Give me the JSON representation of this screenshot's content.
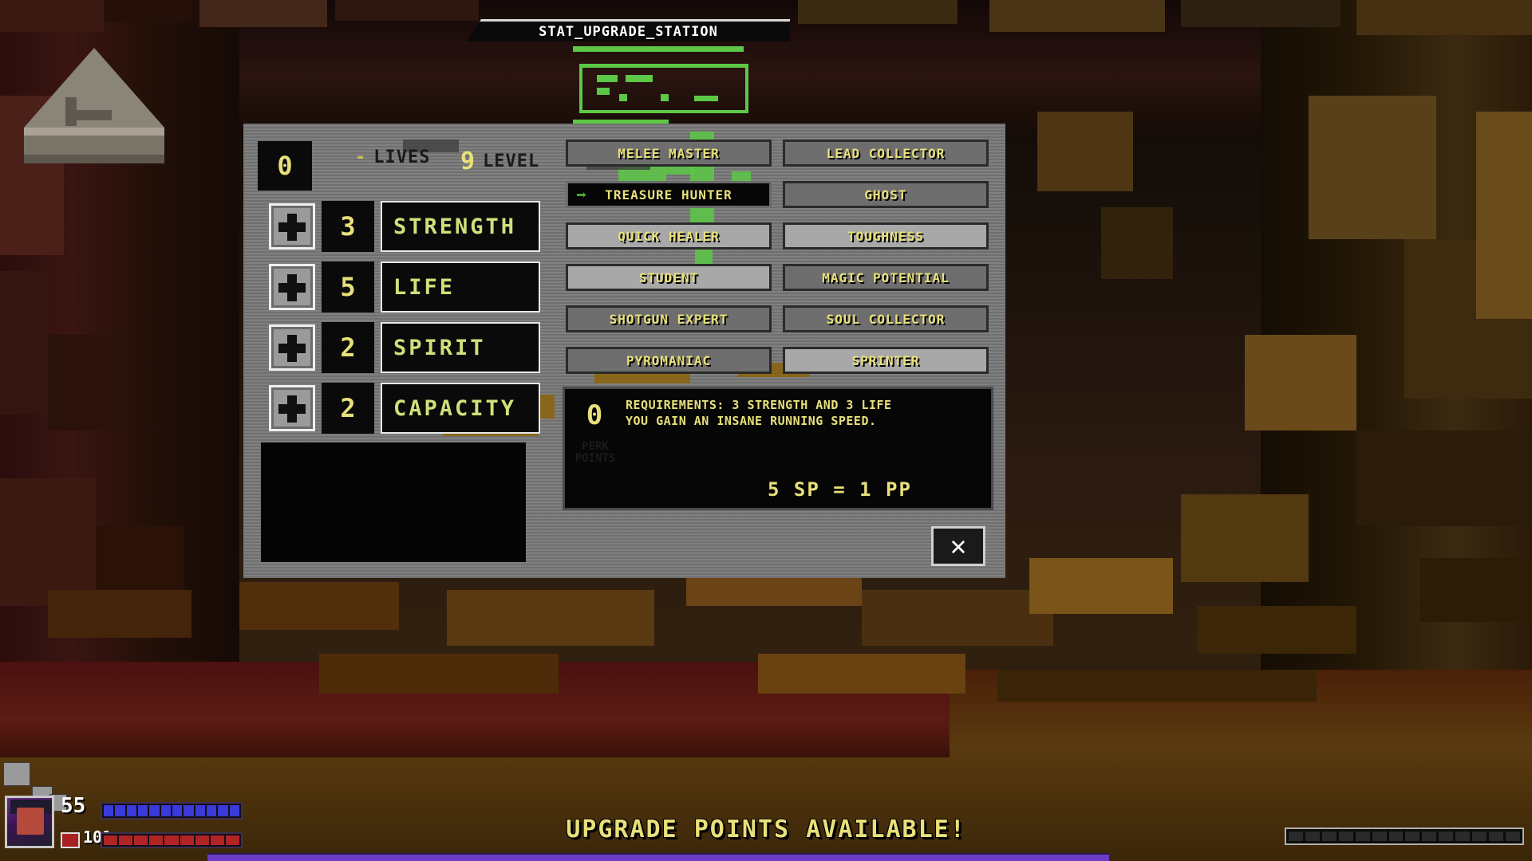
{
  "title_bar": {
    "text": "STAT_UPGRADE_STATION"
  },
  "hud_top": {
    "stat_points": "0",
    "lives_separator": "-",
    "lives_label": "LIVES",
    "level_value": "9",
    "level_label": "LEVEL"
  },
  "stats": [
    {
      "value": "3",
      "name": "STRENGTH",
      "plus_icon": "plus-icon"
    },
    {
      "value": "5",
      "name": "LIFE",
      "plus_icon": "plus-icon"
    },
    {
      "value": "2",
      "name": "SPIRIT",
      "plus_icon": "plus-icon"
    },
    {
      "value": "2",
      "name": "CAPACITY",
      "plus_icon": "plus-icon"
    }
  ],
  "perks": [
    {
      "label": "MELEE MASTER",
      "column": "left",
      "row": 0,
      "state": "available",
      "selected": false
    },
    {
      "label": "LEAD COLLECTOR",
      "column": "right",
      "row": 0,
      "state": "available",
      "selected": false
    },
    {
      "label": "TREASURE HUNTER",
      "column": "left",
      "row": 1,
      "state": "available",
      "selected": true
    },
    {
      "label": "GHOST",
      "column": "right",
      "row": 1,
      "state": "available",
      "selected": false
    },
    {
      "label": "QUICK HEALER",
      "column": "left",
      "row": 2,
      "state": "owned",
      "selected": false
    },
    {
      "label": "TOUGHNESS",
      "column": "right",
      "row": 2,
      "state": "owned",
      "selected": false
    },
    {
      "label": "STUDENT",
      "column": "left",
      "row": 3,
      "state": "owned",
      "selected": false
    },
    {
      "label": "MAGIC POTENTIAL",
      "column": "right",
      "row": 3,
      "state": "available",
      "selected": false
    },
    {
      "label": "SHOTGUN EXPERT",
      "column": "left",
      "row": 4,
      "state": "available",
      "selected": false
    },
    {
      "label": "SOUL COLLECTOR",
      "column": "right",
      "row": 4,
      "state": "available",
      "selected": false
    },
    {
      "label": "PYROMANIAC",
      "column": "left",
      "row": 5,
      "state": "available",
      "selected": false
    },
    {
      "label": "SPRINTER",
      "column": "right",
      "row": 5,
      "state": "owned",
      "selected": false
    }
  ],
  "selection_arrow": "➡",
  "info": {
    "perk_points": "0",
    "perk_points_label_line1": "PERK",
    "perk_points_label_line2": "POINTS",
    "requirements_line": "REQUIREMENTS: 3 STRENGTH AND 3 LIFE",
    "description_line": "YOU GAIN AN INSANE RUNNING SPEED.",
    "conversion": "5 SP = 1 PP"
  },
  "close_button": {
    "glyph": "✕"
  },
  "footer": {
    "banner": "UPGRADE POINTS AVAILABLE!"
  },
  "player_hud": {
    "health": "55",
    "armor": "101",
    "health_segments": 12,
    "armor_segments": 9,
    "ammo_segments": 14
  },
  "colors": {
    "accent_yellow": "#e8e07a",
    "accent_green": "#5cc845",
    "panel_metal": "#7c7c7c",
    "panel_metal_light": "#a8a8a8",
    "panel_dark": "#060606",
    "health_blue": "#3a3ad8",
    "armor_red": "#b02424",
    "banner_purple": "#6a3cc4"
  }
}
